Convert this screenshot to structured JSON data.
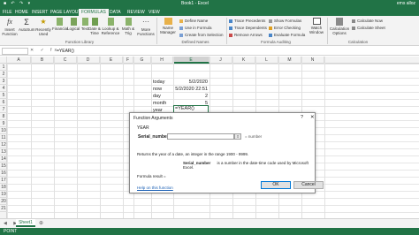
{
  "titlebar": {
    "title": "Book1 - Excel",
    "user": "ems alloz",
    "qat": "■ ↶ ↷ ▾"
  },
  "tabs": [
    "HOME",
    "INSERT",
    "PAGE LAYOUT",
    "FORMULAS",
    "DATA",
    "REVIEW",
    "VIEW"
  ],
  "active_tab": "FORMULAS",
  "ribbon": {
    "insert_function": "Insert\nFunction",
    "autosum": "AutoSum",
    "recently_used": "Recently\nUsed",
    "financial": "Financial",
    "logical": "Logical",
    "text": "Text",
    "date_time": "Date &\nTime",
    "lookup_reference": "Lookup &\nReference",
    "math_trig": "Math &\nTrig",
    "more_functions": "More\nFunctions",
    "function_library_label": "Function Library",
    "name_manager": "Name\nManager",
    "define_name": "Define Name",
    "use_in_formula": "Use in Formula",
    "create_from_selection": "Create from Selection",
    "defined_names_label": "Defined Names",
    "trace_precedents": "Trace Precedents",
    "trace_dependents": "Trace Dependents",
    "remove_arrows": "Remove Arrows",
    "show_formulas": "Show Formulas",
    "error_checking": "Error Checking",
    "evaluate_formula": "Evaluate Formula",
    "formula_auditing_label": "Formula Auditing",
    "watch_window": "Watch\nWindow",
    "calculation_options": "Calculation\nOptions",
    "calculate_now": "Calculate Now",
    "calculate_sheet": "Calculate Sheet",
    "calculation_label": "Calculation"
  },
  "formula_bar": {
    "name_box": "",
    "icons": "✕ ✓ fx",
    "formula": "=YEAR()"
  },
  "columns": [
    "A",
    "B",
    "C",
    "D",
    "E",
    "F",
    "G",
    "H",
    "I",
    "J",
    "K",
    "L",
    "M",
    "N"
  ],
  "selected_column": "E",
  "rows": [
    "1",
    "2",
    "3",
    "4",
    "5",
    "6",
    "7",
    "8",
    "9",
    "10",
    "11",
    "12",
    "13",
    "14",
    "15",
    "16",
    "17",
    "18",
    "19",
    "20",
    "21"
  ],
  "cells": {
    "today_label": "today",
    "today_value": "5/2/2020",
    "now_label": "now",
    "now_value": "5/2/2020 22:51",
    "day_label": "day",
    "day_value": "2",
    "month_label": "month",
    "month_value": "5",
    "year_label": "year",
    "year_formula": "=YEAR()"
  },
  "dialog": {
    "title": "Function Arguments",
    "help": "?",
    "close": "✕",
    "function_name": "YEAR",
    "arg_label": "Serial_number",
    "arg_result": "=  number",
    "arg_button": "⇧",
    "description": "Returns the year of a date, an integer in the range 1900 - 9999.",
    "arg_desc_name": "Serial_number",
    "arg_desc_text": "is a number in the date-time code used by Microsoft Excel.",
    "formula_result": "Formula result =",
    "help_link": "Help on this function",
    "ok": "OK",
    "cancel": "Cancel"
  },
  "sheet_tabs": {
    "nav": "◀ ▶",
    "active": "Sheet1",
    "add": "⊕"
  },
  "status": {
    "mode": "POINT"
  }
}
